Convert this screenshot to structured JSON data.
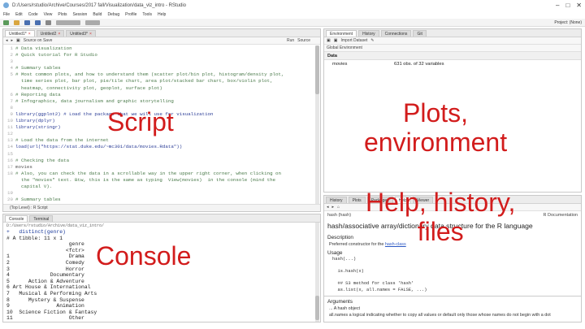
{
  "window": {
    "title": "D:/Users/rstudio/Archive/Courses/2017 fall/Visualization/data_viz_intro - RStudio",
    "controls": [
      "–",
      "□",
      "✕"
    ]
  },
  "menu": [
    "File",
    "Edit",
    "Code",
    "View",
    "Plots",
    "Session",
    "Build",
    "Debug",
    "Profile",
    "Tools",
    "Help"
  ],
  "toolbar": {
    "project": "Project: (None)"
  },
  "script": {
    "tabs": [
      {
        "label": "Untitled1*"
      },
      {
        "label": "Untitled2"
      },
      {
        "label": "Untitled3*"
      }
    ],
    "subbar": [
      "Source on Save",
      "Run",
      "Source"
    ],
    "lines": [
      {
        "n": "1",
        "t": "# Data visualization",
        "c": "cm"
      },
      {
        "n": "2",
        "t": "# Quick tutorial for R Studio",
        "c": "cm"
      },
      {
        "n": "3",
        "t": "",
        "c": ""
      },
      {
        "n": "4",
        "t": "# Summary tables",
        "c": "cm"
      },
      {
        "n": "5",
        "t": "# Most common plots, and how to understand them (scatter plot/bin plot, histogram/density plot,",
        "c": "cm"
      },
      {
        "n": "",
        "t": "  time series plot, bar plot, pie/tile chart, area plot/stacked bar chart, box/violin plot,",
        "c": "cm"
      },
      {
        "n": "",
        "t": "  heatmap, connectivity plot, geoplot, surface plot)",
        "c": "cm"
      },
      {
        "n": "6",
        "t": "# Reporting data",
        "c": "cm"
      },
      {
        "n": "7",
        "t": "# Infographics, data journalism and graphic storytelling",
        "c": "cm"
      },
      {
        "n": "8",
        "t": "",
        "c": ""
      },
      {
        "n": "9",
        "t": "library(ggplot2) # Load the package that we will use for visualization",
        "c": "fn"
      },
      {
        "n": "10",
        "t": "library(dplyr)",
        "c": "fn"
      },
      {
        "n": "11",
        "t": "library(stringr)",
        "c": "fn"
      },
      {
        "n": "12",
        "t": "",
        "c": ""
      },
      {
        "n": "13",
        "t": "# Load the data from the internet",
        "c": "cm"
      },
      {
        "n": "14",
        "t": "load(url(\"https://stat.duke.edu/~mc301/data/movies.Rdata\"))",
        "c": "fn"
      },
      {
        "n": "15",
        "t": "",
        "c": ""
      },
      {
        "n": "16",
        "t": "# Checking the data",
        "c": "cm"
      },
      {
        "n": "17",
        "t": "movies",
        "c": "kw"
      },
      {
        "n": "18",
        "t": "# Also, you can check the data in a scrollable way in the upper right corner, when clicking on",
        "c": "cm"
      },
      {
        "n": "",
        "t": "  the \"movies\" text. Btw, this is the same as typing  View(movies)  in the console (mind the",
        "c": "cm"
      },
      {
        "n": "",
        "t": "  capital V).",
        "c": "cm"
      },
      {
        "n": "19",
        "t": "",
        "c": ""
      },
      {
        "n": "20",
        "t": "# Summary tables",
        "c": "cm"
      }
    ],
    "status": "(Top Level) :    R Script"
  },
  "console": {
    "tabs": [
      {
        "label": "Console"
      },
      {
        "label": "Terminal"
      }
    ],
    "path": "D:/Users/rstudio/Archive/data_viz_intro/",
    "lines": [
      {
        "t": "+   distinct(genre)",
        "c": "cmd"
      },
      {
        "t": "# A tibble: 11 x 1",
        "c": ""
      },
      {
        "t": "                    genre",
        "c": ""
      },
      {
        "t": "                   <fctr>",
        "c": ""
      },
      {
        "t": "1                   Drama",
        "c": ""
      },
      {
        "t": "2                  Comedy",
        "c": ""
      },
      {
        "t": "3                  Horror",
        "c": ""
      },
      {
        "t": "4             Documentary",
        "c": ""
      },
      {
        "t": "5      Action & Adventure",
        "c": ""
      },
      {
        "t": "6 Art House & International",
        "c": ""
      },
      {
        "t": "7   Musical & Performing Arts",
        "c": ""
      },
      {
        "t": "8      Mystery & Suspense",
        "c": ""
      },
      {
        "t": "9               Animation",
        "c": ""
      },
      {
        "t": "10  Science Fiction & Fantasy",
        "c": ""
      },
      {
        "t": "11                  Other",
        "c": ""
      },
      {
        "t": "> View(movies)",
        "c": "cmd"
      },
      {
        "t": "> View(movies)",
        "c": "cmd"
      },
      {
        "t": ">",
        "c": "cmd"
      }
    ]
  },
  "environment": {
    "tabs": [
      {
        "label": "Environment"
      },
      {
        "label": "History"
      },
      {
        "label": "Connections"
      },
      {
        "label": "Git"
      }
    ],
    "subbar": [
      "Import Dataset",
      "Global Environment"
    ],
    "section": "Data",
    "rows": [
      {
        "name": "movies",
        "value": "631 obs. of 32 variables"
      }
    ]
  },
  "help": {
    "tabs": [
      {
        "label": "History"
      },
      {
        "label": "Plots"
      },
      {
        "label": "Packages"
      },
      {
        "label": "Help"
      },
      {
        "label": "Viewer"
      }
    ],
    "topic_left": "hash (hash)",
    "topic_right": "R Documentation",
    "title": "hash/associative array/dictionary data structure for the R language",
    "description_h": "Description",
    "description": "Preferred constructor for the",
    "description_link": "hash-class",
    "usage_h": "Usage",
    "usage_code": "hash(...)\n\n  is.hash(x)\n\n  ## S3 method for class 'hash'\n  as.list(x, all.names = FALSE, ...)",
    "arguments_h": "Arguments",
    "arg1": "...      A hash object",
    "arg2": "all.names  a logical indicating whether to copy all values or default only those whose names do not begin with a dot"
  },
  "overlays": {
    "script": "Script",
    "plots": "Plots,\nenvironment",
    "help": "Help, history,\nfiles",
    "console": "Console"
  }
}
